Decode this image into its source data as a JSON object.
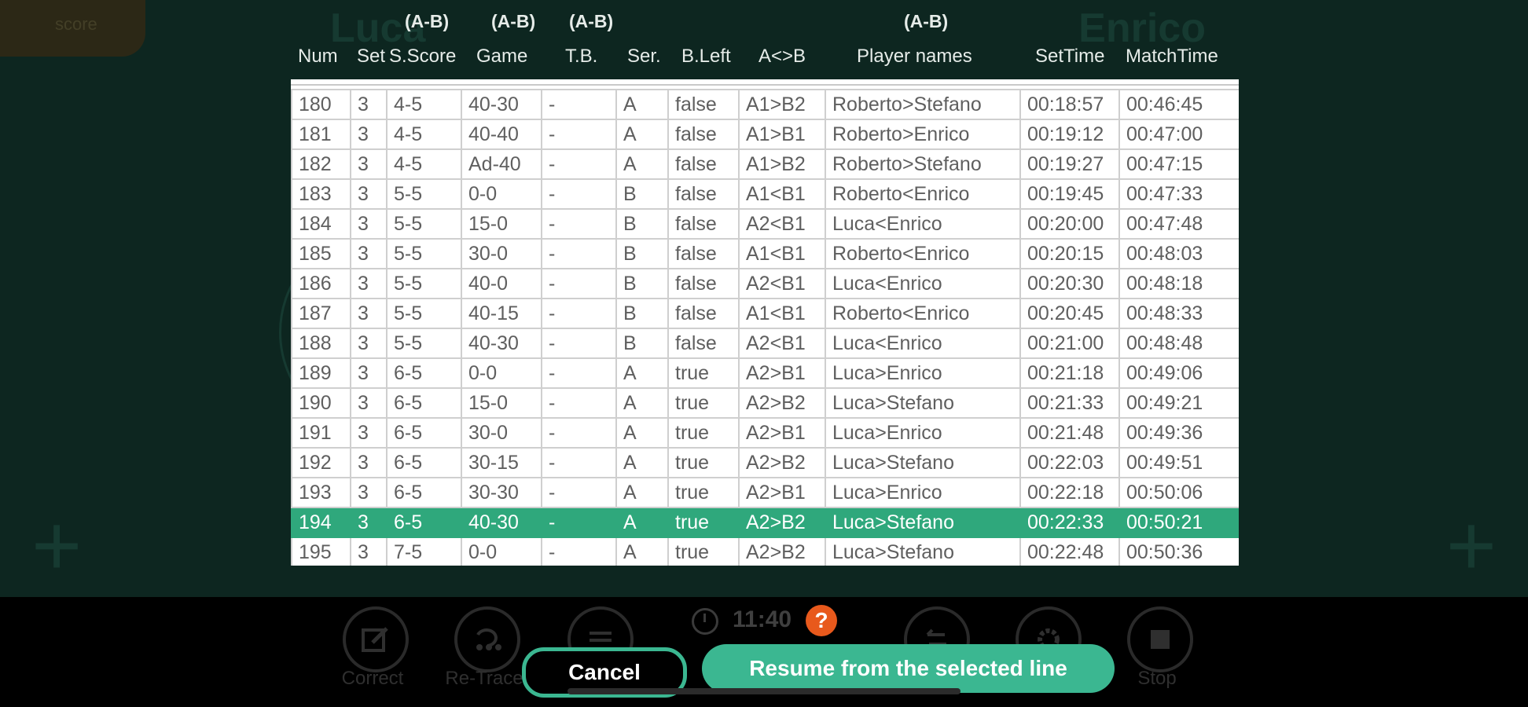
{
  "background": {
    "player_left": "Luca",
    "player_right": "Enrico",
    "score_badge": "score"
  },
  "header": {
    "ab_label": "(A-B)",
    "columns": [
      "Num",
      "Set",
      "S.Score",
      "Game",
      "T.B.",
      "Ser.",
      "B.Left",
      "A<>B",
      "Player names",
      "SetTime",
      "MatchTime"
    ]
  },
  "rows": [
    {
      "num": "180",
      "set": "3",
      "sscore": "4-5",
      "game": "40-30",
      "tb": "-",
      "ser": "A",
      "bleft": "false",
      "ab": "A1>B2",
      "players": "Roberto>Stefano",
      "settime": "00:18:57",
      "matchtime": "00:46:45"
    },
    {
      "num": "181",
      "set": "3",
      "sscore": "4-5",
      "game": "40-40",
      "tb": "-",
      "ser": "A",
      "bleft": "false",
      "ab": "A1>B1",
      "players": "Roberto>Enrico",
      "settime": "00:19:12",
      "matchtime": "00:47:00"
    },
    {
      "num": "182",
      "set": "3",
      "sscore": "4-5",
      "game": "Ad-40",
      "tb": "-",
      "ser": "A",
      "bleft": "false",
      "ab": "A1>B2",
      "players": "Roberto>Stefano",
      "settime": "00:19:27",
      "matchtime": "00:47:15"
    },
    {
      "num": "183",
      "set": "3",
      "sscore": "5-5",
      "game": "0-0",
      "tb": "-",
      "ser": "B",
      "bleft": "false",
      "ab": "A1<B1",
      "players": "Roberto<Enrico",
      "settime": "00:19:45",
      "matchtime": "00:47:33"
    },
    {
      "num": "184",
      "set": "3",
      "sscore": "5-5",
      "game": "15-0",
      "tb": "-",
      "ser": "B",
      "bleft": "false",
      "ab": "A2<B1",
      "players": "Luca<Enrico",
      "settime": "00:20:00",
      "matchtime": "00:47:48"
    },
    {
      "num": "185",
      "set": "3",
      "sscore": "5-5",
      "game": "30-0",
      "tb": "-",
      "ser": "B",
      "bleft": "false",
      "ab": "A1<B1",
      "players": "Roberto<Enrico",
      "settime": "00:20:15",
      "matchtime": "00:48:03"
    },
    {
      "num": "186",
      "set": "3",
      "sscore": "5-5",
      "game": "40-0",
      "tb": "-",
      "ser": "B",
      "bleft": "false",
      "ab": "A2<B1",
      "players": "Luca<Enrico",
      "settime": "00:20:30",
      "matchtime": "00:48:18"
    },
    {
      "num": "187",
      "set": "3",
      "sscore": "5-5",
      "game": "40-15",
      "tb": "-",
      "ser": "B",
      "bleft": "false",
      "ab": "A1<B1",
      "players": "Roberto<Enrico",
      "settime": "00:20:45",
      "matchtime": "00:48:33"
    },
    {
      "num": "188",
      "set": "3",
      "sscore": "5-5",
      "game": "40-30",
      "tb": "-",
      "ser": "B",
      "bleft": "false",
      "ab": "A2<B1",
      "players": "Luca<Enrico",
      "settime": "00:21:00",
      "matchtime": "00:48:48"
    },
    {
      "num": "189",
      "set": "3",
      "sscore": "6-5",
      "game": "0-0",
      "tb": "-",
      "ser": "A",
      "bleft": "true",
      "ab": "A2>B1",
      "players": "Luca>Enrico",
      "settime": "00:21:18",
      "matchtime": "00:49:06"
    },
    {
      "num": "190",
      "set": "3",
      "sscore": "6-5",
      "game": "15-0",
      "tb": "-",
      "ser": "A",
      "bleft": "true",
      "ab": "A2>B2",
      "players": "Luca>Stefano",
      "settime": "00:21:33",
      "matchtime": "00:49:21"
    },
    {
      "num": "191",
      "set": "3",
      "sscore": "6-5",
      "game": "30-0",
      "tb": "-",
      "ser": "A",
      "bleft": "true",
      "ab": "A2>B1",
      "players": "Luca>Enrico",
      "settime": "00:21:48",
      "matchtime": "00:49:36"
    },
    {
      "num": "192",
      "set": "3",
      "sscore": "6-5",
      "game": "30-15",
      "tb": "-",
      "ser": "A",
      "bleft": "true",
      "ab": "A2>B2",
      "players": "Luca>Stefano",
      "settime": "00:22:03",
      "matchtime": "00:49:51"
    },
    {
      "num": "193",
      "set": "3",
      "sscore": "6-5",
      "game": "30-30",
      "tb": "-",
      "ser": "A",
      "bleft": "true",
      "ab": "A2>B1",
      "players": "Luca>Enrico",
      "settime": "00:22:18",
      "matchtime": "00:50:06"
    },
    {
      "num": "194",
      "set": "3",
      "sscore": "6-5",
      "game": "40-30",
      "tb": "-",
      "ser": "A",
      "bleft": "true",
      "ab": "A2>B2",
      "players": "Luca>Stefano",
      "settime": "00:22:33",
      "matchtime": "00:50:21",
      "selected": true
    },
    {
      "num": "195",
      "set": "3",
      "sscore": "7-5",
      "game": "0-0",
      "tb": "-",
      "ser": "A",
      "bleft": "true",
      "ab": "A2>B2",
      "players": "Luca>Stefano",
      "settime": "00:22:48",
      "matchtime": "00:50:36"
    }
  ],
  "toolbar": {
    "correct_label": "Correct",
    "retrace_label": "Re-Trace",
    "stop_label": "Stop",
    "clock_icon": "clock-icon",
    "timer": "11:40",
    "help": "?"
  },
  "actions": {
    "cancel_label": "Cancel",
    "resume_label": "Resume from the selected line"
  },
  "colors": {
    "accent": "#3bb791",
    "selected_row": "#2fa87c",
    "help": "#e8591c"
  }
}
